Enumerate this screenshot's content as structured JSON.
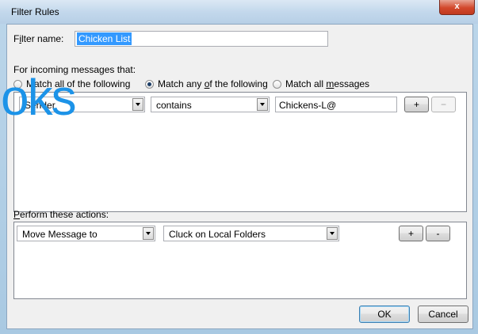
{
  "window": {
    "title": "Filter Rules",
    "close_label": "x"
  },
  "watermark": {
    "text": "oks"
  },
  "filter_name": {
    "label_prefix": "F",
    "label_underlined": "i",
    "label_rest": "lter name:",
    "value": "Chicken List"
  },
  "incoming": {
    "label": "For incoming messages that:"
  },
  "match_options": [
    {
      "label": "Match all of the following",
      "checked": false
    },
    {
      "label_pre": "Match any ",
      "label_ul": "o",
      "label_post": "f the following",
      "checked": true
    },
    {
      "label_pre": "Match all ",
      "label_ul": "m",
      "label_post": "essages",
      "checked": false
    }
  ],
  "rule": {
    "field": "Sender",
    "operator": "contains",
    "value": "Chickens-L@",
    "add_label": "+",
    "remove_label": "−"
  },
  "actions": {
    "label_ul": "P",
    "label_rest": "erform these actions:",
    "action": "Move Message to",
    "target": "Cluck on Local Folders",
    "add_label": "+",
    "remove_label": "-"
  },
  "footer": {
    "ok_label": "OK",
    "cancel_label": "Cancel"
  }
}
